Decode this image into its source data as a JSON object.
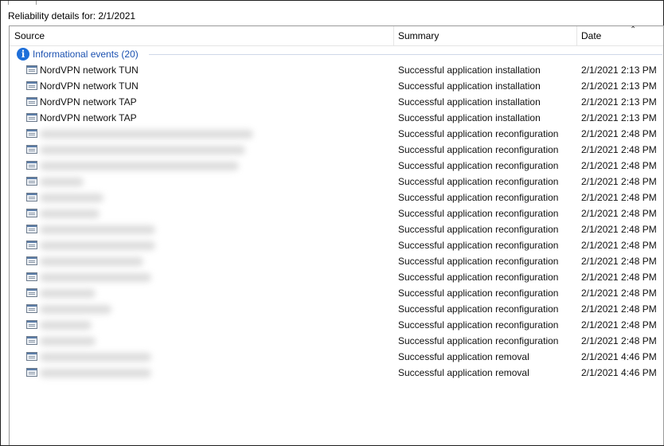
{
  "title": "Reliability details for: 2/1/2021",
  "columns": {
    "source": "Source",
    "summary": "Summary",
    "date": "Date"
  },
  "group": {
    "label": "Informational events (20)",
    "icon": "info-icon"
  },
  "rows": [
    {
      "source": "NordVPN network TUN",
      "summary": "Successful application installation",
      "date": "2/1/2021 2:13 PM"
    },
    {
      "source": "NordVPN network TUN",
      "summary": "Successful application installation",
      "date": "2/1/2021 2:13 PM"
    },
    {
      "source": "NordVPN network TAP",
      "summary": "Successful application installation",
      "date": "2/1/2021 2:13 PM"
    },
    {
      "source": "NordVPN network TAP",
      "summary": "Successful application installation",
      "date": "2/1/2021 2:13 PM"
    },
    {
      "source": "",
      "summary": "Successful application reconfiguration",
      "date": "2/1/2021 2:48 PM",
      "blurred": true
    },
    {
      "source": "",
      "summary": "Successful application reconfiguration",
      "date": "2/1/2021 2:48 PM",
      "blurred": true
    },
    {
      "source": "",
      "summary": "Successful application reconfiguration",
      "date": "2/1/2021 2:48 PM",
      "blurred": true
    },
    {
      "source": "",
      "summary": "Successful application reconfiguration",
      "date": "2/1/2021 2:48 PM",
      "blurred": true
    },
    {
      "source": "",
      "summary": "Successful application reconfiguration",
      "date": "2/1/2021 2:48 PM",
      "blurred": true
    },
    {
      "source": "",
      "summary": "Successful application reconfiguration",
      "date": "2/1/2021 2:48 PM",
      "blurred": true
    },
    {
      "source": "",
      "summary": "Successful application reconfiguration",
      "date": "2/1/2021 2:48 PM",
      "blurred": true
    },
    {
      "source": "",
      "summary": "Successful application reconfiguration",
      "date": "2/1/2021 2:48 PM",
      "blurred": true
    },
    {
      "source": "",
      "summary": "Successful application reconfiguration",
      "date": "2/1/2021 2:48 PM",
      "blurred": true
    },
    {
      "source": "",
      "summary": "Successful application reconfiguration",
      "date": "2/1/2021 2:48 PM",
      "blurred": true
    },
    {
      "source": "",
      "summary": "Successful application reconfiguration",
      "date": "2/1/2021 2:48 PM",
      "blurred": true
    },
    {
      "source": "",
      "summary": "Successful application reconfiguration",
      "date": "2/1/2021 2:48 PM",
      "blurred": true
    },
    {
      "source": "",
      "summary": "Successful application reconfiguration",
      "date": "2/1/2021 2:48 PM",
      "blurred": true
    },
    {
      "source": "",
      "summary": "Successful application reconfiguration",
      "date": "2/1/2021 2:48 PM",
      "blurred": true
    },
    {
      "source": "",
      "summary": "Successful application removal",
      "date": "2/1/2021 4:46 PM",
      "blurred": true
    },
    {
      "source": "",
      "summary": "Successful application removal",
      "date": "2/1/2021 4:46 PM",
      "blurred": true
    }
  ],
  "colors": {
    "group_text": "#1a50b0",
    "info_icon": "#1e6fd9",
    "border": "#1f1f1f"
  },
  "sort": {
    "column": "date",
    "icon": "sort-caret-up-icon"
  }
}
